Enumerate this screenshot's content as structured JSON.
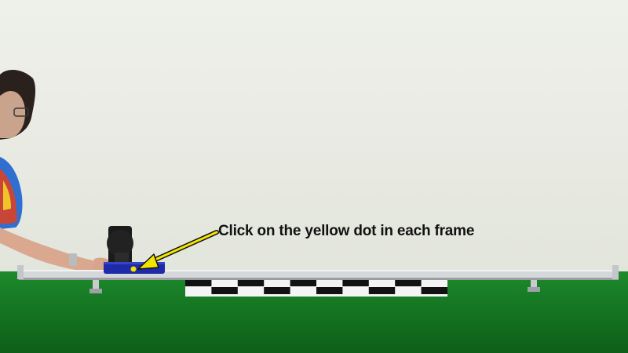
{
  "instruction": {
    "text": "Click on the yellow dot in each frame"
  },
  "scene": {
    "marker_color": "#f2e600",
    "arrow_color": "#f2e600",
    "cart_color": "#1f2aa8",
    "table_color": "#178427",
    "wall_color": "#eceee6"
  }
}
